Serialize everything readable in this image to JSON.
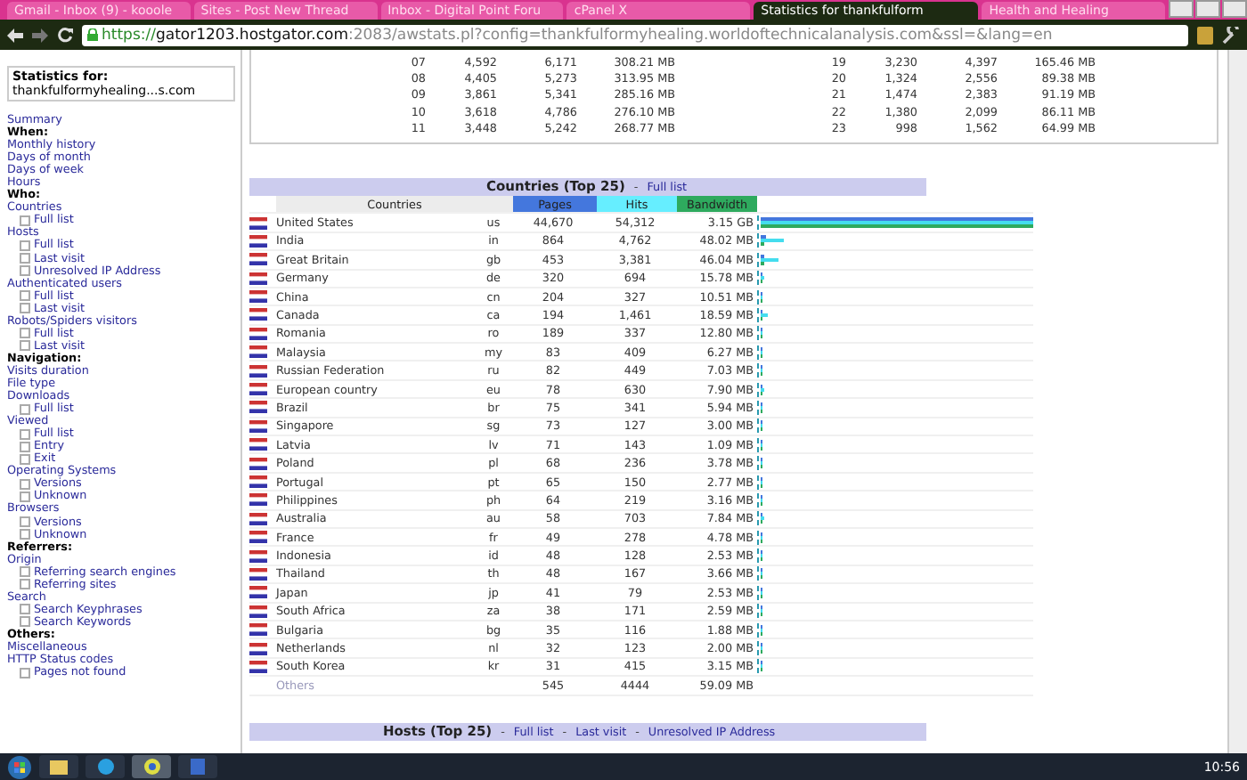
{
  "browser": {
    "tabs": [
      {
        "title": "Gmail - Inbox (9) - kooole",
        "selected": false
      },
      {
        "title": "Sites - Post New Thread",
        "selected": false
      },
      {
        "title": "Inbox - Digital Point Foru",
        "selected": false
      },
      {
        "title": "cPanel X",
        "selected": false
      },
      {
        "title": "Statistics for thankfulform",
        "selected": true
      },
      {
        "title": "Health and Healing",
        "selected": false
      }
    ],
    "url_scheme": "https://",
    "url_host": "gator1203.hostgator.com",
    "url_rest": ":2083/awstats.pl?config=thankfulformyhealing.worldoftechnicalanalysis.com&ssl=&lang=en"
  },
  "sidebar": {
    "stats_label": "Statistics for:",
    "site": "thankfulformyhealing...s.com",
    "items": [
      {
        "kind": "link",
        "label": "Summary"
      },
      {
        "kind": "heading",
        "label": "When:"
      },
      {
        "kind": "link",
        "label": "Monthly history"
      },
      {
        "kind": "link",
        "label": "Days of month"
      },
      {
        "kind": "link",
        "label": "Days of week"
      },
      {
        "kind": "link",
        "label": "Hours"
      },
      {
        "kind": "heading",
        "label": "Who:"
      },
      {
        "kind": "link",
        "label": "Countries",
        "children": [
          {
            "label": "Full list"
          }
        ]
      },
      {
        "kind": "link",
        "label": "Hosts",
        "children": [
          {
            "label": "Full list"
          },
          {
            "label": "Last visit"
          },
          {
            "label": "Unresolved IP Address"
          }
        ]
      },
      {
        "kind": "link",
        "label": "Authenticated users",
        "children": [
          {
            "label": "Full list"
          },
          {
            "label": "Last visit"
          }
        ]
      },
      {
        "kind": "link",
        "label": "Robots/Spiders visitors",
        "children": [
          {
            "label": "Full list"
          },
          {
            "label": "Last visit"
          }
        ]
      },
      {
        "kind": "heading",
        "label": "Navigation:"
      },
      {
        "kind": "link",
        "label": "Visits duration"
      },
      {
        "kind": "link",
        "label": "File type"
      },
      {
        "kind": "link",
        "label": "Downloads",
        "children": [
          {
            "label": "Full list"
          }
        ]
      },
      {
        "kind": "link",
        "label": "Viewed",
        "children": [
          {
            "label": "Full list"
          },
          {
            "label": "Entry"
          },
          {
            "label": "Exit"
          }
        ]
      },
      {
        "kind": "link",
        "label": "Operating Systems",
        "children": [
          {
            "label": "Versions"
          },
          {
            "label": "Unknown"
          }
        ]
      },
      {
        "kind": "link",
        "label": "Browsers",
        "children": [
          {
            "label": "Versions"
          },
          {
            "label": "Unknown"
          }
        ]
      },
      {
        "kind": "heading",
        "label": "Referrers:"
      },
      {
        "kind": "link",
        "label": "Origin",
        "children": [
          {
            "label": "Referring search engines"
          },
          {
            "label": "Referring sites"
          }
        ]
      },
      {
        "kind": "link",
        "label": "Search",
        "children": [
          {
            "label": "Search Keyphrases"
          },
          {
            "label": "Search Keywords"
          }
        ]
      },
      {
        "kind": "heading",
        "label": "Others:"
      },
      {
        "kind": "link",
        "label": "Miscellaneous"
      },
      {
        "kind": "link",
        "label": "HTTP Status codes",
        "children": [
          {
            "label": "Pages not found"
          }
        ]
      }
    ]
  },
  "hours": {
    "left": [
      {
        "hour": "07",
        "pages": "4,592",
        "hits": "6,171",
        "bandwidth": "308.21 MB"
      },
      {
        "hour": "08",
        "pages": "4,405",
        "hits": "5,273",
        "bandwidth": "313.95 MB"
      },
      {
        "hour": "09",
        "pages": "3,861",
        "hits": "5,341",
        "bandwidth": "285.16 MB"
      },
      {
        "hour": "10",
        "pages": "3,618",
        "hits": "4,786",
        "bandwidth": "276.10 MB"
      },
      {
        "hour": "11",
        "pages": "3,448",
        "hits": "5,242",
        "bandwidth": "268.77 MB"
      }
    ],
    "right": [
      {
        "hour": "19",
        "pages": "3,230",
        "hits": "4,397",
        "bandwidth": "165.46 MB"
      },
      {
        "hour": "20",
        "pages": "1,324",
        "hits": "2,556",
        "bandwidth": "89.38 MB"
      },
      {
        "hour": "21",
        "pages": "1,474",
        "hits": "2,383",
        "bandwidth": "91.19 MB"
      },
      {
        "hour": "22",
        "pages": "1,380",
        "hits": "2,099",
        "bandwidth": "86.11 MB"
      },
      {
        "hour": "23",
        "pages": "998",
        "hits": "1,562",
        "bandwidth": "64.99 MB"
      }
    ]
  },
  "countries": {
    "title": "Countries (Top 25)",
    "separator": "-",
    "full_list": "Full list",
    "columns": {
      "country": "Countries",
      "pages": "Pages",
      "hits": "Hits",
      "bandwidth": "Bandwidth"
    },
    "rows": [
      {
        "name": "United States",
        "code": "us",
        "pages": "44,670",
        "hits": "54,312",
        "bandwidth": "3.15 GB"
      },
      {
        "name": "India",
        "code": "in",
        "pages": "864",
        "hits": "4,762",
        "bandwidth": "48.02 MB"
      },
      {
        "name": "Great Britain",
        "code": "gb",
        "pages": "453",
        "hits": "3,381",
        "bandwidth": "46.04 MB"
      },
      {
        "name": "Germany",
        "code": "de",
        "pages": "320",
        "hits": "694",
        "bandwidth": "15.78 MB"
      },
      {
        "name": "China",
        "code": "cn",
        "pages": "204",
        "hits": "327",
        "bandwidth": "10.51 MB"
      },
      {
        "name": "Canada",
        "code": "ca",
        "pages": "194",
        "hits": "1,461",
        "bandwidth": "18.59 MB"
      },
      {
        "name": "Romania",
        "code": "ro",
        "pages": "189",
        "hits": "337",
        "bandwidth": "12.80 MB"
      },
      {
        "name": "Malaysia",
        "code": "my",
        "pages": "83",
        "hits": "409",
        "bandwidth": "6.27 MB"
      },
      {
        "name": "Russian Federation",
        "code": "ru",
        "pages": "82",
        "hits": "449",
        "bandwidth": "7.03 MB"
      },
      {
        "name": "European country",
        "code": "eu",
        "pages": "78",
        "hits": "630",
        "bandwidth": "7.90 MB"
      },
      {
        "name": "Brazil",
        "code": "br",
        "pages": "75",
        "hits": "341",
        "bandwidth": "5.94 MB"
      },
      {
        "name": "Singapore",
        "code": "sg",
        "pages": "73",
        "hits": "127",
        "bandwidth": "3.00 MB"
      },
      {
        "name": "Latvia",
        "code": "lv",
        "pages": "71",
        "hits": "143",
        "bandwidth": "1.09 MB"
      },
      {
        "name": "Poland",
        "code": "pl",
        "pages": "68",
        "hits": "236",
        "bandwidth": "3.78 MB"
      },
      {
        "name": "Portugal",
        "code": "pt",
        "pages": "65",
        "hits": "150",
        "bandwidth": "2.77 MB"
      },
      {
        "name": "Philippines",
        "code": "ph",
        "pages": "64",
        "hits": "219",
        "bandwidth": "3.16 MB"
      },
      {
        "name": "Australia",
        "code": "au",
        "pages": "58",
        "hits": "703",
        "bandwidth": "7.84 MB"
      },
      {
        "name": "France",
        "code": "fr",
        "pages": "49",
        "hits": "278",
        "bandwidth": "4.78 MB"
      },
      {
        "name": "Indonesia",
        "code": "id",
        "pages": "48",
        "hits": "128",
        "bandwidth": "2.53 MB"
      },
      {
        "name": "Thailand",
        "code": "th",
        "pages": "48",
        "hits": "167",
        "bandwidth": "3.66 MB"
      },
      {
        "name": "Japan",
        "code": "jp",
        "pages": "41",
        "hits": "79",
        "bandwidth": "2.53 MB"
      },
      {
        "name": "South Africa",
        "code": "za",
        "pages": "38",
        "hits": "171",
        "bandwidth": "2.59 MB"
      },
      {
        "name": "Bulgaria",
        "code": "bg",
        "pages": "35",
        "hits": "116",
        "bandwidth": "1.88 MB"
      },
      {
        "name": "Netherlands",
        "code": "nl",
        "pages": "32",
        "hits": "123",
        "bandwidth": "2.00 MB"
      },
      {
        "name": "South Korea",
        "code": "kr",
        "pages": "31",
        "hits": "415",
        "bandwidth": "3.15 MB"
      }
    ],
    "others": {
      "label": "Others",
      "pages": "545",
      "hits": "4444",
      "bandwidth": "59.09 MB"
    }
  },
  "hosts": {
    "title": "Hosts (Top 25)",
    "separator": "-",
    "links": [
      "Full list",
      "Last visit",
      "Unresolved IP Address"
    ]
  },
  "taskbar": {
    "clock": "10:56"
  }
}
